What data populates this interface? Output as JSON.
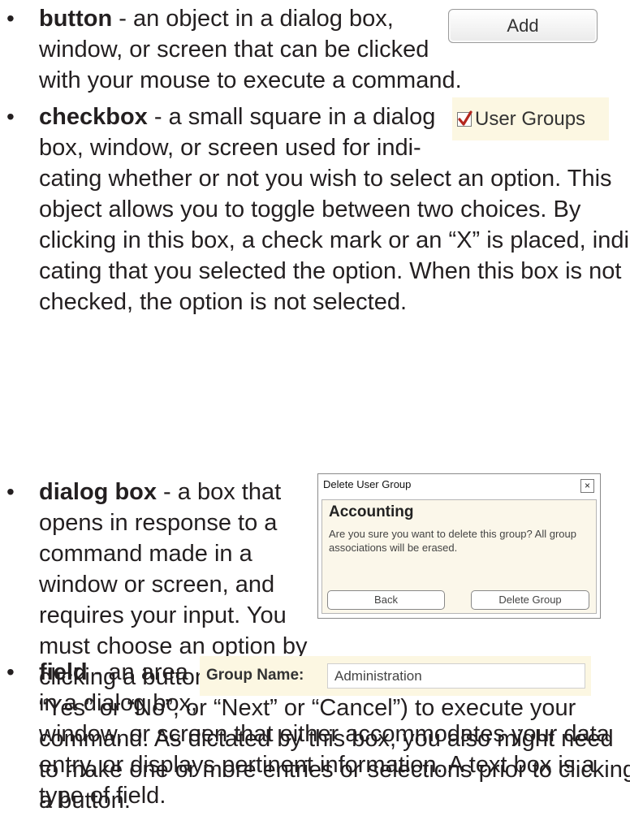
{
  "bullet_symbol": "•",
  "entries": [
    {
      "term": "button",
      "lines": [
        " - an object in a dialog box,",
        "window, or screen that can be clicked",
        "with your mouse to execute a command."
      ],
      "figure": {
        "label": "Add"
      }
    },
    {
      "term": "checkbox",
      "lines": [
        " - a small square in a dialog",
        "box, window, or screen used for indi-",
        "cating whether or not you wish to select an option. This",
        "object allows you to toggle between two choices. By",
        "clicking in this box, a check mark or an “X” is placed, indi-",
        "cating that you selected the option. When this box is not",
        "checked, the option is not selected."
      ],
      "figure": {
        "label": "User Groups",
        "checked": true,
        "check_color": "#b3261e"
      }
    },
    {
      "term": "dialog box",
      "lines": [
        " - a box that",
        "opens in response to a",
        "command made in a",
        "window or screen, and",
        "requires your input. You",
        "must choose an option by",
        "clicking a button (such as",
        "“Yes” or “No”, or “Next” or “Cancel”) to execute your",
        "command. As dictated by this box, you also might need",
        "to make one or more entries or selections prior to clicking",
        "a button."
      ],
      "figure": {
        "window_title": "Delete User Group",
        "close_glyph": "×",
        "heading": "Accounting",
        "message": "Are you sure you want to delete this group?  All group associations will be erased.",
        "back_label": "Back",
        "delete_label": "Delete Group"
      }
    },
    {
      "term": "field",
      "lines": [
        " - an area",
        "in a dialog box,",
        "window, or screen that either accommodates your data",
        "entry, or displays pertinent information. A text box is a",
        "type of field."
      ],
      "figure": {
        "label": "Group Name:",
        "value": "Administration"
      }
    }
  ]
}
